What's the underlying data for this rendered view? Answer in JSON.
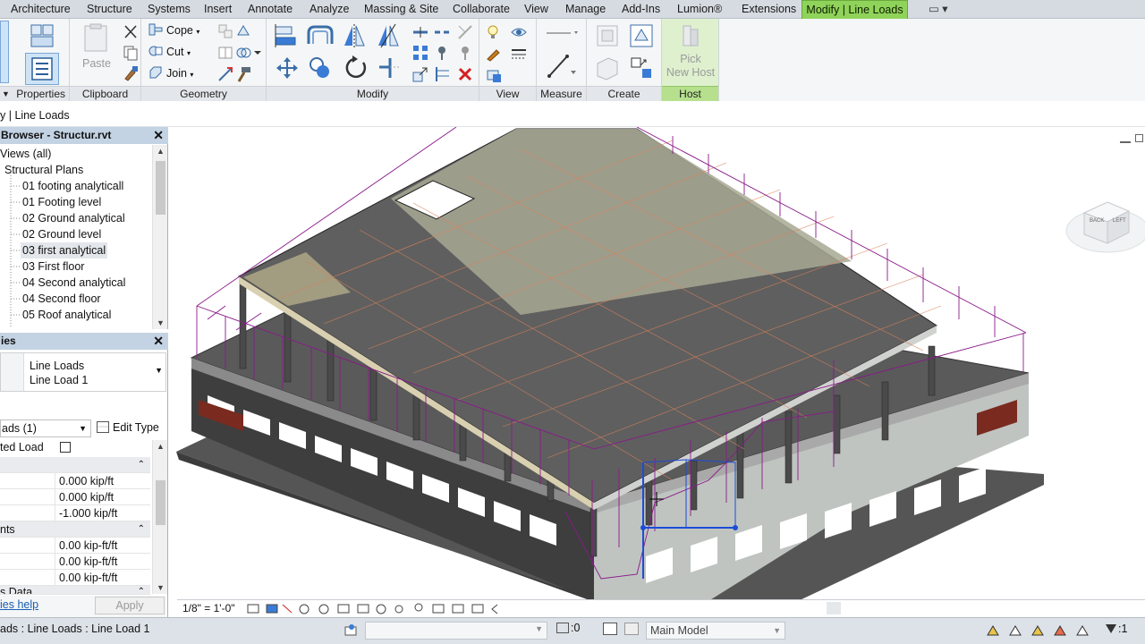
{
  "menu": {
    "tabs": [
      {
        "label": "Architecture"
      },
      {
        "label": "Structure"
      },
      {
        "label": "Systems"
      },
      {
        "label": "Insert"
      },
      {
        "label": "Annotate"
      },
      {
        "label": "Analyze"
      },
      {
        "label": "Massing & Site"
      },
      {
        "label": "Collaborate"
      },
      {
        "label": "View"
      },
      {
        "label": "Manage"
      },
      {
        "label": "Add-Ins"
      },
      {
        "label": "Lumion®"
      },
      {
        "label": "Extensions"
      },
      {
        "label": "Modify | Line Loads"
      }
    ],
    "options_glyph": "▭ ▾"
  },
  "ribbon": {
    "panels": {
      "properties": "Properties",
      "clipboard": "Clipboard",
      "geometry": "Geometry",
      "modify": "Modify",
      "view": "View",
      "measure": "Measure",
      "create": "Create",
      "host": "Host"
    },
    "paste_label": "Paste",
    "cope_label": "Cope",
    "cut_label": "Cut",
    "join_label": "Join",
    "pick_new_host": "Pick\nNew Host",
    "pick_line1": "Pick",
    "pick_line2": "New Host"
  },
  "context_bar": {
    "label": "y | Line Loads"
  },
  "project_browser": {
    "title": "Browser - Structur.rvt",
    "items": [
      {
        "label": "Views (all)"
      },
      {
        "label": "Structural Plans"
      },
      {
        "label": "01 footing analyticall"
      },
      {
        "label": "01 Footing level"
      },
      {
        "label": "02 Ground analytical"
      },
      {
        "label": "02 Ground level"
      },
      {
        "label": "03 first analytical"
      },
      {
        "label": "03 First floor"
      },
      {
        "label": "04 Second analytical"
      },
      {
        "label": "04 Second floor"
      },
      {
        "label": "05 Roof analytical"
      }
    ]
  },
  "properties": {
    "title": "ies",
    "type_line1": "Line Loads",
    "type_line2": "Line Load 1",
    "filter": "ads (1)",
    "edit_type": "Edit Type",
    "uniform_load": "ted Load",
    "force_values": [
      "0.000 kip/ft",
      "0.000 kip/ft",
      "-1.000 kip/ft"
    ],
    "moments_group": "nts",
    "moment_values": [
      "0.00 kip-ft/ft",
      "0.00 kip-ft/ft",
      "0.00 kip-ft/ft"
    ],
    "data_group": "s Data",
    "help_link": "ies help",
    "apply_label": "Apply"
  },
  "view_control": {
    "scale": "1/8\" = 1'-0\""
  },
  "status": {
    "message": "ads : Line Loads : Line Load 1",
    "coord": ":0",
    "model": "Main Model",
    "filter_count": ":1"
  },
  "viewcube": {
    "face1": "BACK",
    "face2": "LEFT"
  },
  "colors": {
    "context_tab": "#8fd35a",
    "slab": "#5f5f5f",
    "load_line": "#8a1a8a",
    "selection": "#1c4cd8"
  }
}
